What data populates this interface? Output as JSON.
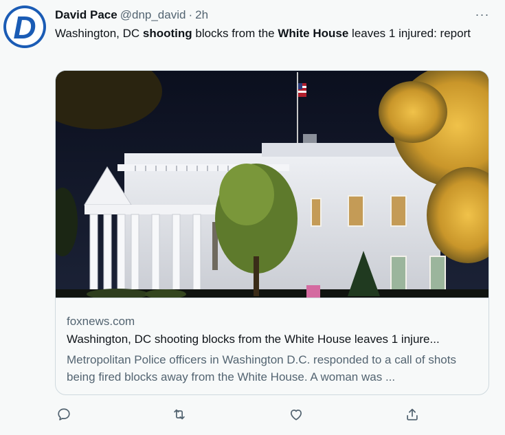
{
  "tweet": {
    "author": {
      "display_name": "David Pace",
      "handle": "@dnp_david",
      "separator": "·",
      "time": "2h",
      "avatar_letter": "D",
      "avatar_color": "#1b5cb5"
    },
    "more_icon": "more-options-icon",
    "more_glyph": "···",
    "text_parts": [
      {
        "text": "Washington, DC ",
        "bold": false
      },
      {
        "text": "shooting",
        "bold": true
      },
      {
        "text": " blocks from the ",
        "bold": false
      },
      {
        "text": "White House",
        "bold": true
      },
      {
        "text": " leaves 1 injured: report",
        "bold": false
      }
    ],
    "card": {
      "image_subject": "white-house-at-night-image",
      "domain": "foxnews.com",
      "title": "Washington, DC shooting blocks from the White House leaves 1 injure...",
      "description": "Metropolitan Police officers in Washington D.C. responded to a call of shots being fired blocks away from the White House. A woman was ..."
    },
    "actions": [
      {
        "name": "reply-button",
        "icon": "reply-icon"
      },
      {
        "name": "retweet-button",
        "icon": "retweet-icon"
      },
      {
        "name": "like-button",
        "icon": "like-icon"
      },
      {
        "name": "share-button",
        "icon": "share-icon"
      }
    ]
  },
  "colors": {
    "text_primary": "#0f1419",
    "text_secondary": "#536471",
    "border": "#cfd9de",
    "background": "#f7f9f9"
  }
}
